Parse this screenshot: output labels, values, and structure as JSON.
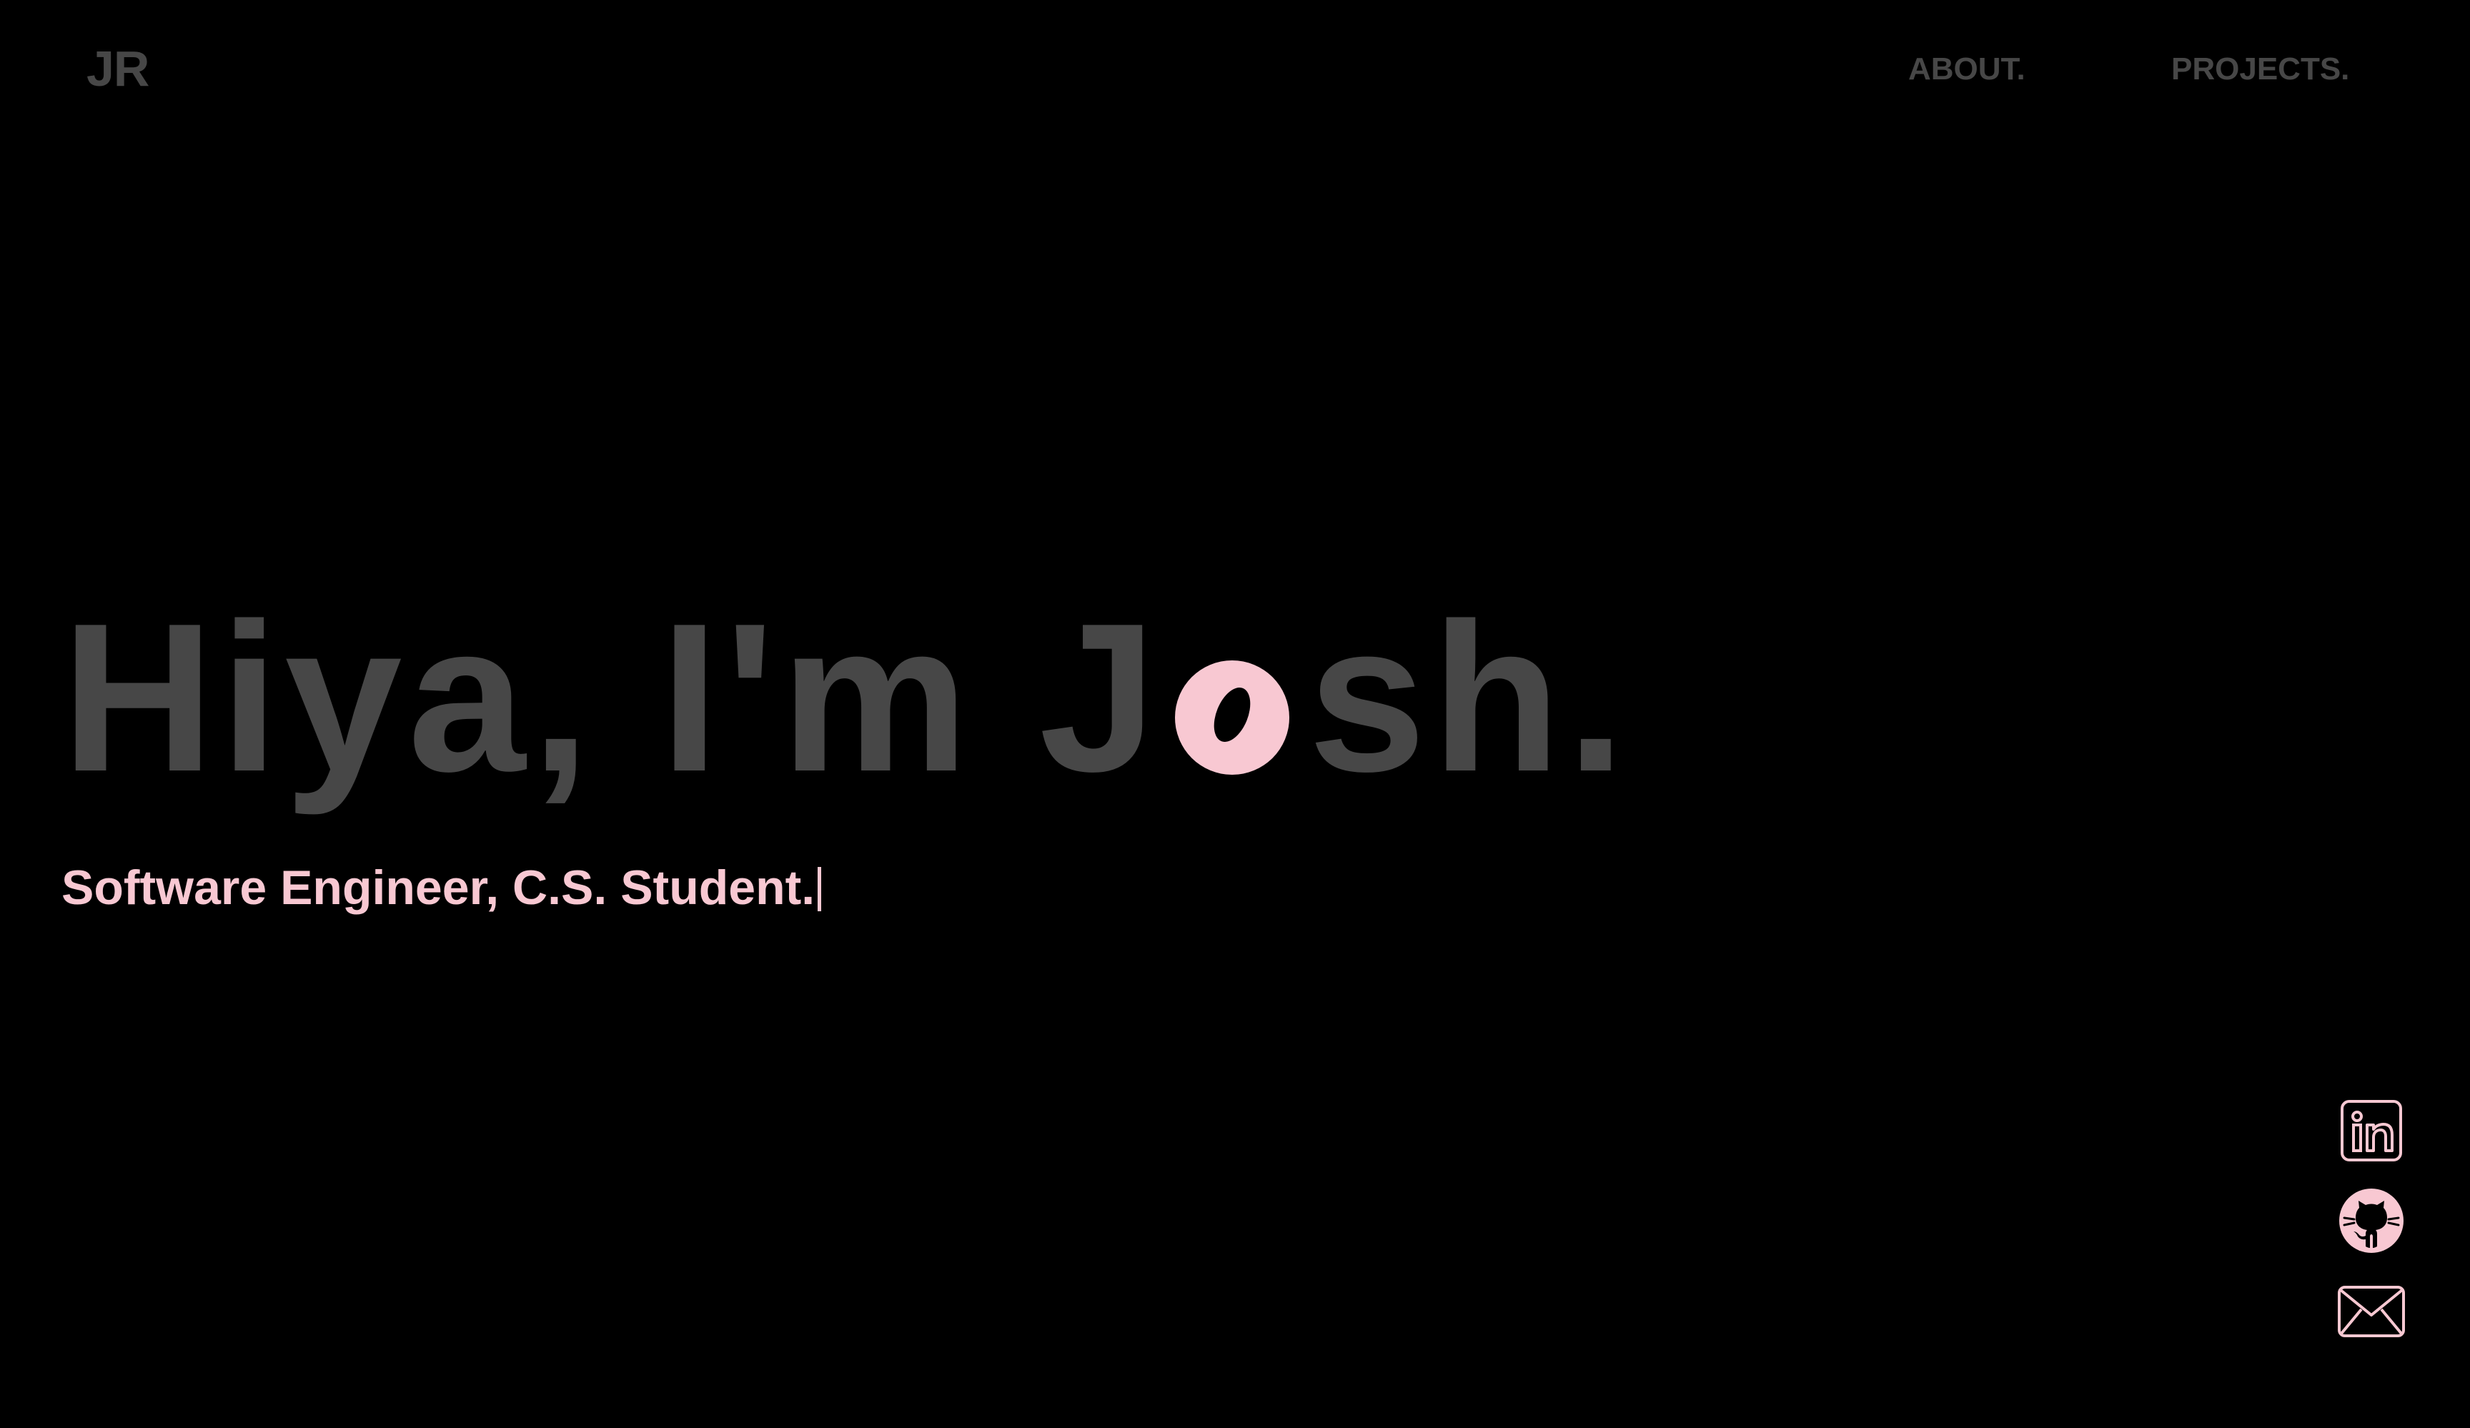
{
  "header": {
    "logo": "JR",
    "nav": [
      {
        "label": "ABOUT."
      },
      {
        "label": "PROJECTS."
      }
    ]
  },
  "hero": {
    "title_before": "Hiya, I'm J",
    "title_after": "sh.",
    "subtitle": "Software Engineer, C.S. Student."
  },
  "social": [
    {
      "icon": "linkedin-icon"
    },
    {
      "icon": "github-icon"
    },
    {
      "icon": "mail-icon"
    }
  ],
  "colors": {
    "background": "#000000",
    "muted_text": "#474747",
    "accent_pink": "#f8c8d2"
  }
}
